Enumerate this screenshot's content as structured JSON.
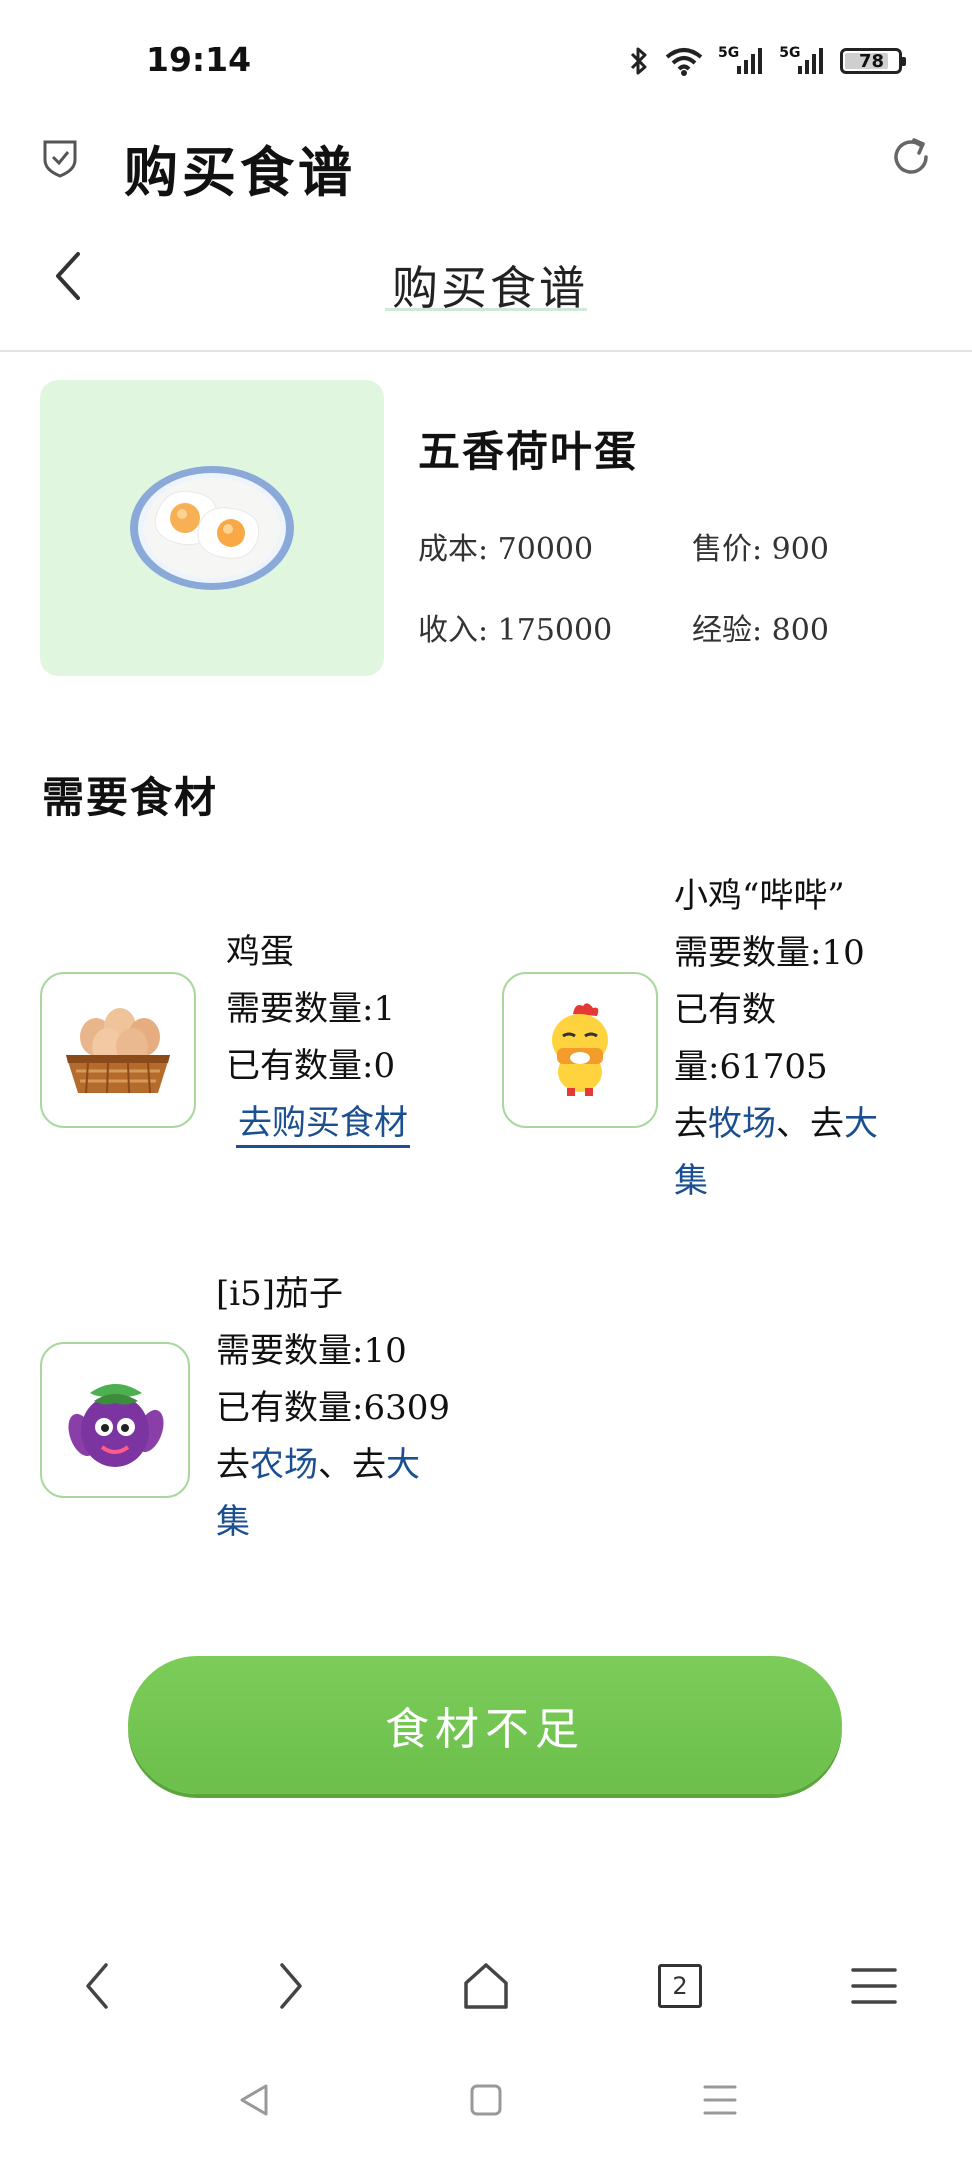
{
  "status_bar": {
    "time": "19:14",
    "network_1": "5G",
    "network_2": "5G",
    "battery": "78",
    "battery_level": 0.78
  },
  "browser": {
    "title": "购买食谱"
  },
  "page": {
    "title": "购买食谱"
  },
  "recipe": {
    "name": "五香荷叶蛋",
    "cost": "成本: 70000",
    "price": "售价: 900",
    "income": "收入: 175000",
    "exp": "经验: 800"
  },
  "section_title": "需要食材",
  "ingredients": [
    {
      "name": "鸡蛋",
      "need": "需要数量:1",
      "have": "已有数量:0",
      "buy_link": "去购买食材",
      "icon": "egg-basket-icon"
    },
    {
      "name": "小鸡“哔哔”",
      "need": "需要数量:10",
      "have_1": "已有数",
      "have_2": "量:61705",
      "go1": "去",
      "link1": "牧场",
      "sep": "、去",
      "link2_a": "大",
      "link2_b": "集",
      "icon": "chick-icon"
    },
    {
      "name": "[i5]茄子",
      "need": "需要数量:10",
      "have": "已有数量:6309",
      "go1": "去",
      "link1": "农场",
      "sep": "、去",
      "link2_a": "大",
      "link2_b": "集",
      "icon": "eggplant-icon"
    }
  ],
  "main_button": "食材不足",
  "bottom_nav": {
    "tab_count": "2"
  },
  "colors": {
    "accent_green": "#6cbf4b",
    "card_bg": "#e1f6df",
    "link_blue": "#1b4f8f"
  }
}
